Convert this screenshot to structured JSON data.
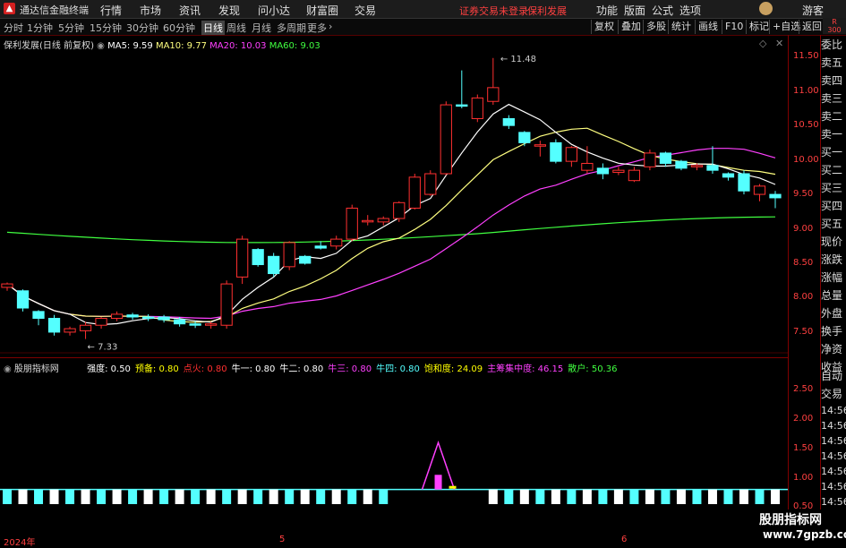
{
  "menubar": {
    "app_title": "通达信金融终端",
    "items": [
      "行情",
      "市场",
      "资讯",
      "发现",
      "问小达",
      "财富圈",
      "交易"
    ],
    "login_warning": "证券交易未登录",
    "stock_name": "保利发展",
    "right_items": [
      "功能",
      "版面",
      "公式",
      "选项"
    ],
    "guest": "游客"
  },
  "toolbar": {
    "periods": [
      "分时",
      "1分钟",
      "5分钟",
      "15分钟",
      "30分钟",
      "60分钟",
      "日线",
      "周线",
      "月线",
      "多周期",
      "更多"
    ],
    "active_period": "日线",
    "buttons": [
      "复权",
      "叠加",
      "多股",
      "统计",
      "画线",
      "F10",
      "标记",
      "+自选",
      "返回"
    ],
    "badge_top": "R",
    "badge_bottom": "300"
  },
  "main_chart": {
    "stock_label": "保利发展(日线 前复权)",
    "ma5_label": "MA5: 9.59",
    "ma10_label": "MA10: 9.77",
    "ma20_label": "MA20: 10.03",
    "ma60_label": "MA60: 9.03",
    "high_label": "11.48",
    "low_label": "7.33",
    "y_ticks": [
      "11.50",
      "11.00",
      "10.50",
      "10.00",
      "9.50",
      "9.00",
      "8.50",
      "8.00",
      "7.50"
    ],
    "colors": {
      "up": "#ff3030",
      "down": "#54ffff",
      "ma5": "#ffffff",
      "ma10": "#ffff80",
      "ma20": "#ff40ff",
      "ma60": "#40ff40"
    }
  },
  "indicator": {
    "name": "股朋指标网",
    "labels": [
      {
        "text": "强度: 0.50",
        "color": "#ffffff"
      },
      {
        "text": "预备: 0.80",
        "color": "#ffff00"
      },
      {
        "text": "点火: 0.80",
        "color": "#ff3030"
      },
      {
        "text": "牛一: 0.80",
        "color": "#ffffff"
      },
      {
        "text": "牛二: 0.80",
        "color": "#ffffff"
      },
      {
        "text": "牛三: 0.80",
        "color": "#ff40ff"
      },
      {
        "text": "牛四: 0.80",
        "color": "#54ffff"
      },
      {
        "text": "饱和度: 24.09",
        "color": "#ffff00"
      },
      {
        "text": "主筹集中度: 46.15",
        "color": "#ff40ff"
      },
      {
        "text": "散户: 50.36",
        "color": "#40ff40"
      }
    ],
    "y_ticks": [
      "2.50",
      "2.00",
      "1.50",
      "1.00",
      "0.50"
    ]
  },
  "side_panel": {
    "items": [
      "委比",
      "卖五",
      "卖四",
      "卖三",
      "卖二",
      "卖一",
      "买一",
      "买二",
      "买三",
      "买四",
      "买五",
      "现价",
      "涨跌",
      "涨幅",
      "总量",
      "外盘",
      "换手",
      "净资",
      "收益"
    ],
    "lower_items": [
      "自动",
      "交易",
      "14:56",
      "14:56",
      "14:56",
      "14:56",
      "14:56",
      "14:56",
      "14:56",
      "14:56",
      "14:56"
    ]
  },
  "dates": [
    "2024年",
    "5",
    "6"
  ],
  "watermark": {
    "line1": "股朋指标网",
    "line2": "www.7gpzb.com"
  },
  "chart_data": {
    "type": "candlestick",
    "series": [
      {
        "name": "K线",
        "ohlc": [
          [
            8.15,
            8.22,
            8.1,
            8.2
          ],
          [
            8.1,
            8.12,
            7.8,
            7.85
          ],
          [
            7.8,
            7.82,
            7.6,
            7.7
          ],
          [
            7.7,
            7.75,
            7.45,
            7.5
          ],
          [
            7.5,
            7.58,
            7.45,
            7.55
          ],
          [
            7.52,
            7.65,
            7.4,
            7.6
          ],
          [
            7.6,
            7.72,
            7.55,
            7.7
          ],
          [
            7.7,
            7.8,
            7.66,
            7.76
          ],
          [
            7.75,
            7.78,
            7.68,
            7.72
          ],
          [
            7.72,
            7.76,
            7.66,
            7.7
          ],
          [
            7.72,
            7.75,
            7.64,
            7.68
          ],
          [
            7.68,
            7.72,
            7.58,
            7.62
          ],
          [
            7.62,
            7.66,
            7.56,
            7.6
          ],
          [
            7.6,
            7.65,
            7.55,
            7.62
          ],
          [
            7.6,
            8.25,
            7.55,
            8.2
          ],
          [
            8.3,
            8.9,
            8.2,
            8.85
          ],
          [
            8.7,
            8.72,
            8.45,
            8.48
          ],
          [
            8.6,
            8.65,
            8.3,
            8.35
          ],
          [
            8.45,
            8.82,
            8.4,
            8.8
          ],
          [
            8.6,
            8.62,
            8.48,
            8.5
          ],
          [
            8.75,
            8.82,
            8.7,
            8.72
          ],
          [
            8.75,
            8.9,
            8.7,
            8.85
          ],
          [
            8.85,
            9.35,
            8.82,
            9.3
          ],
          [
            9.1,
            9.2,
            9.05,
            9.12
          ],
          [
            9.1,
            9.18,
            9.05,
            9.15
          ],
          [
            9.15,
            9.4,
            9.1,
            9.38
          ],
          [
            9.3,
            9.8,
            9.28,
            9.75
          ],
          [
            9.5,
            9.85,
            9.48,
            9.8
          ],
          [
            9.8,
            10.85,
            9.78,
            10.8
          ],
          [
            10.8,
            11.3,
            10.75,
            10.78
          ],
          [
            10.6,
            10.95,
            10.55,
            10.9
          ],
          [
            10.85,
            11.48,
            10.8,
            11.05
          ],
          [
            10.6,
            10.65,
            10.45,
            10.5
          ],
          [
            10.4,
            10.42,
            10.2,
            10.25
          ],
          [
            10.2,
            10.28,
            10.05,
            10.22
          ],
          [
            10.25,
            10.3,
            9.95,
            9.98
          ],
          [
            9.98,
            10.2,
            9.9,
            10.18
          ],
          [
            9.85,
            10.2,
            9.8,
            9.95
          ],
          [
            9.88,
            9.95,
            9.72,
            9.8
          ],
          [
            9.82,
            9.9,
            9.78,
            9.85
          ],
          [
            9.7,
            9.9,
            9.68,
            9.85
          ],
          [
            9.9,
            10.15,
            9.85,
            10.1
          ],
          [
            10.1,
            10.12,
            9.9,
            9.95
          ],
          [
            9.98,
            10.0,
            9.85,
            9.88
          ],
          [
            9.9,
            9.95,
            9.85,
            9.92
          ],
          [
            9.92,
            10.2,
            9.8,
            9.85
          ],
          [
            9.8,
            9.82,
            9.7,
            9.75
          ],
          [
            9.8,
            9.85,
            9.5,
            9.55
          ],
          [
            9.5,
            9.65,
            9.4,
            9.62
          ],
          [
            9.5,
            9.55,
            9.3,
            9.45
          ]
        ]
      }
    ],
    "ylim": [
      7.2,
      11.75
    ]
  }
}
